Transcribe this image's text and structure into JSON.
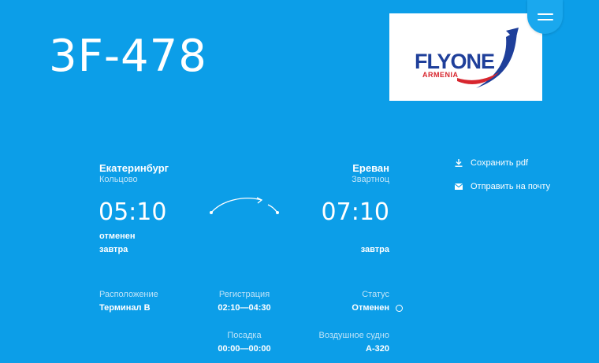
{
  "flight": {
    "number": "3F-478"
  },
  "logo": {
    "text": "FLYONE",
    "subtext": "ARMENIA"
  },
  "departure": {
    "city": "Екатеринбург",
    "airport": "Кольцово",
    "time": "05:10",
    "status": "отменен",
    "day": "завтра"
  },
  "arrival": {
    "city": "Ереван",
    "airport": "Звартноц",
    "time": "07:10",
    "day": "завтра"
  },
  "actions": {
    "save_pdf": "Сохранить pdf",
    "send_email": "Отправить на почту"
  },
  "details": {
    "location_label": "Расположение",
    "location_value": "Терминал B",
    "checkin_label": "Регистрация",
    "checkin_value": "02:10—04:30",
    "status_label": "Статус",
    "status_value": "Отменен",
    "boarding_label": "Посадка",
    "boarding_value": "00:00—00:00",
    "aircraft_label": "Воздушное судно",
    "aircraft_value": "A-320"
  },
  "colors": {
    "background": "#0c9ee8",
    "logo_blue": "#1f3f9a",
    "logo_red": "#d7262e"
  },
  "icons": {
    "menu": "hamburger-icon",
    "download": "download-icon",
    "mail": "mail-icon",
    "status": "ring-icon"
  }
}
